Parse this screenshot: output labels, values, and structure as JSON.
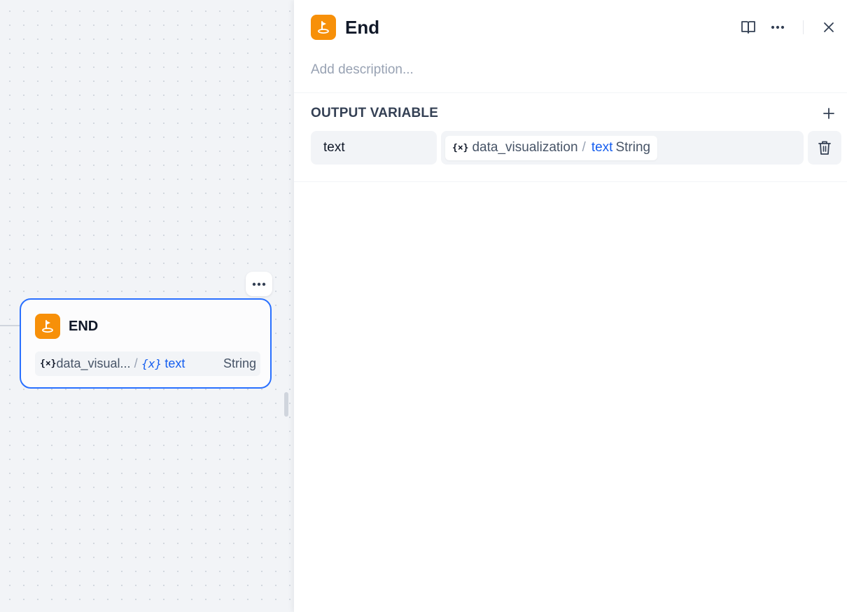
{
  "node": {
    "title": "END",
    "more_glyph": "•••",
    "var": {
      "x_icon": "{×}",
      "source": "data_visual...",
      "separator": "/",
      "x_icon_blue": "{x}",
      "field": "text",
      "type": "String"
    }
  },
  "panel": {
    "title": "End",
    "description_placeholder": "Add description...",
    "section_title": "OUTPUT VARIABLE",
    "output": {
      "name": "text",
      "x_icon": "{×}",
      "source": "data_visualization",
      "separator": "/",
      "field": "text",
      "type": "String"
    },
    "icons": {
      "header": [
        "book-icon",
        "more-horizontal-icon",
        "close-icon"
      ],
      "node": "end-flag-icon",
      "add": "plus-icon",
      "delete": "trash-icon"
    }
  },
  "colors": {
    "accent": "#2970ff",
    "node_icon_bg": "#f79009",
    "link_blue": "#155eef",
    "canvas_bg": "#f2f4f7"
  }
}
